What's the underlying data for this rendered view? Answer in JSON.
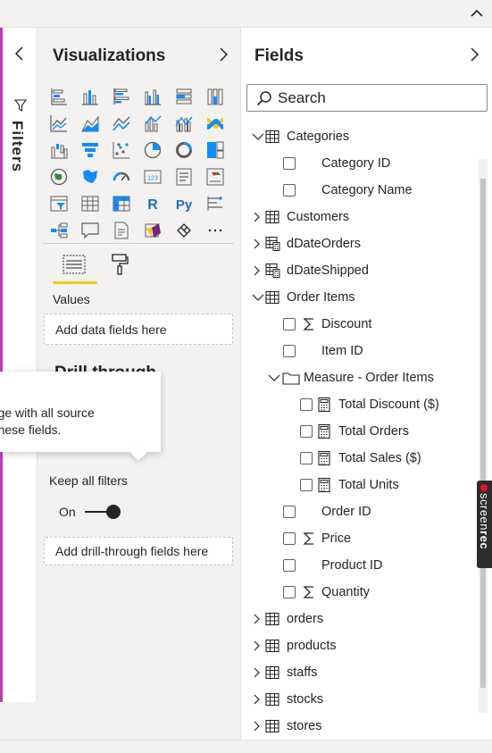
{
  "filters_pane": {
    "label": "Filters",
    "collapse_icon": "chevron-left-icon",
    "funnel_icon": "funnel-icon"
  },
  "visualizations_pane": {
    "title": "Visualizations",
    "expand_icon": "chevron-right-icon",
    "visual_icons": [
      "stacked-bar-chart",
      "stacked-column-chart",
      "clustered-bar-chart",
      "clustered-column-chart",
      "100-stacked-bar-chart",
      "100-stacked-column-chart",
      "line-chart",
      "area-chart",
      "stacked-area-chart",
      "line-and-stacked-column-chart",
      "line-and-clustered-column-chart",
      "ribbon-chart",
      "waterfall-chart",
      "funnel-chart",
      "scatter-chart",
      "pie-chart",
      "donut-chart",
      "treemap",
      "map",
      "filled-map",
      "gauge",
      "card",
      "multi-row-card",
      "kpi",
      "slicer",
      "table",
      "matrix",
      "r-visual",
      "python-visual",
      "key-influencers",
      "decomposition-tree",
      "qa-visual",
      "paginated-report",
      "power-apps",
      "power-automate",
      "more-visuals"
    ],
    "tabs": {
      "fields_tab": "fields-tab-icon",
      "format_tab": "paint-roller-icon"
    },
    "values_label": "Values",
    "values_dropzone": "Add data fields here",
    "drill_through_title": "Drill through",
    "tooltip_lines": [
      "page with all source",
      "n these fields."
    ],
    "keep_all_filters_label": "Keep all filters",
    "toggle_label": "On",
    "toggle_value": true,
    "drill_dropzone": "Add drill-through fields here"
  },
  "fields_pane": {
    "title": "Fields",
    "expand_icon": "chevron-right-icon",
    "search_placeholder": "Search",
    "tree": [
      {
        "label": "Categories",
        "type": "table",
        "expanded": true
      },
      {
        "label": "Category ID",
        "type": "field"
      },
      {
        "label": "Category Name",
        "type": "field"
      },
      {
        "label": "Customers",
        "type": "table",
        "expanded": false
      },
      {
        "label": "dDateOrders",
        "type": "calc-table",
        "expanded": false
      },
      {
        "label": "dDateShipped",
        "type": "calc-table",
        "expanded": false
      },
      {
        "label": "Order Items",
        "type": "table",
        "expanded": true
      },
      {
        "label": "Discount",
        "type": "sum-field"
      },
      {
        "label": "Item ID",
        "type": "field"
      },
      {
        "label": "Measure - Order Items",
        "type": "folder",
        "expanded": true
      },
      {
        "label": "Total Discount ($)",
        "type": "measure"
      },
      {
        "label": "Total Orders",
        "type": "measure"
      },
      {
        "label": "Total Sales ($)",
        "type": "measure"
      },
      {
        "label": "Total Units",
        "type": "measure"
      },
      {
        "label": "Order ID",
        "type": "field"
      },
      {
        "label": "Price",
        "type": "sum-field"
      },
      {
        "label": "Product ID",
        "type": "field"
      },
      {
        "label": "Quantity",
        "type": "sum-field"
      },
      {
        "label": "orders",
        "type": "table",
        "expanded": false
      },
      {
        "label": "products",
        "type": "table",
        "expanded": false
      },
      {
        "label": "staffs",
        "type": "table",
        "expanded": false
      },
      {
        "label": "stocks",
        "type": "table",
        "expanded": false
      },
      {
        "label": "stores",
        "type": "table",
        "expanded": false
      }
    ]
  },
  "badge": {
    "text_light": "screen",
    "text_bold": "rec"
  },
  "colors": {
    "accent_yellow": "#f2c811",
    "filters_accent": "#c239b3",
    "icon_blue": "#118dff",
    "badge_red": "#e81123"
  }
}
